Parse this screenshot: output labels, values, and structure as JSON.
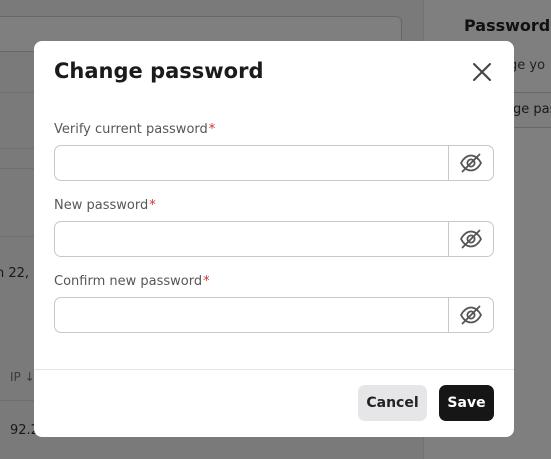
{
  "background": {
    "panel_title": "Password",
    "panel_text": "ge yo",
    "panel_button": "ge pas",
    "date_fragment": "n 22, 2",
    "table_header": "IP ↓",
    "table_ip": "92.2"
  },
  "modal": {
    "title": "Change password",
    "fields": [
      {
        "label": "Verify current password",
        "required_mark": "*",
        "value": ""
      },
      {
        "label": "New password",
        "required_mark": "*",
        "value": ""
      },
      {
        "label": "Confirm new password",
        "required_mark": "*",
        "value": ""
      }
    ],
    "cancel_label": "Cancel",
    "save_label": "Save"
  },
  "icons": {
    "close": "close-icon",
    "visibility": "eye-off-icon"
  },
  "colors": {
    "required": "#d03232",
    "primary_button": "#161616",
    "secondary_button": "#e6e6e9"
  }
}
